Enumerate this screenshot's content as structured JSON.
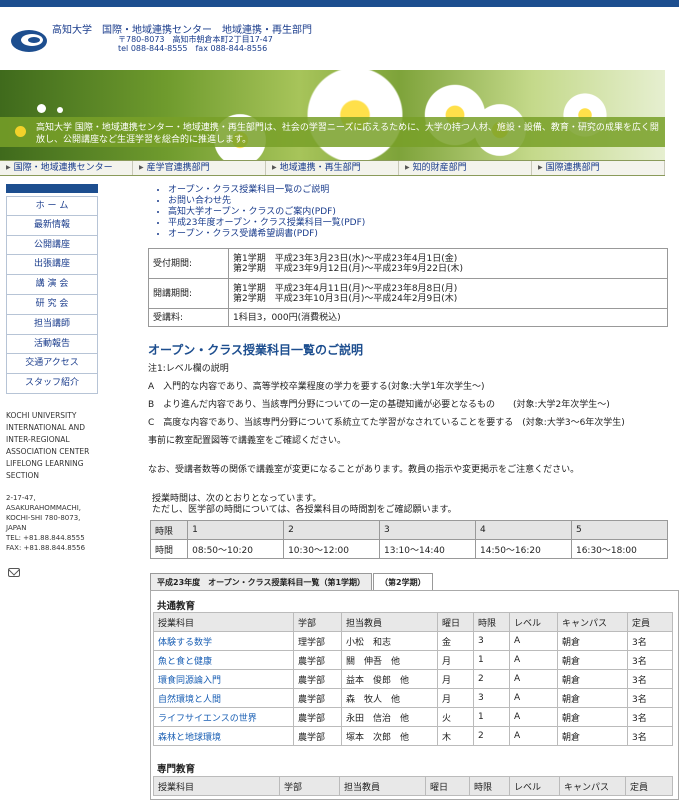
{
  "header": {
    "title": "高知大学　国際・地域連携センター　地域連携・再生部門",
    "addr1": "〒780-8073　高知市朝倉本町2丁目17-47",
    "addr2": "tel 088-844-8555　fax 088-844-8556"
  },
  "banner": {
    "text": "高知大学 国際・地域連携センター・地域連携・再生部門は、社会の学習ニーズに応えるために、大学の持つ人材、施設・設備、教育・研究の成果を広く開放し、公開講座など生涯学習を総合的に推進します。"
  },
  "nav": [
    "国際・地域連携センター",
    "産学官連携部門",
    "地域連携・再生部門",
    "知的財産部門",
    "国際連携部門"
  ],
  "sidebar": {
    "items": [
      "ホ ー ム",
      "最新情報",
      "公開講座",
      "出張講座",
      "講 演 会",
      "研 究 会",
      "担当講師",
      "活動報告",
      "交通アクセス",
      "スタッフ紹介"
    ],
    "en": [
      "KOCHI UNIVERSITY",
      "INTERNATIONAL AND",
      "INTER-REGIONAL",
      "ASSOCIATION CENTER",
      "LIFELONG LEARNING",
      "SECTION"
    ],
    "addr": [
      "2-17-47,",
      "ASAKURAHOMMACHI,",
      "KOCHI-SHI 780-8073,",
      "JAPAN",
      "TEL: +81.88.844.8555",
      "FAX: +81.88.844.8556"
    ]
  },
  "links": [
    "オープン・クラス授業科目一覧のご説明",
    "お問い合わせ先",
    "高知大学オープン・クラスのご案内(PDF)",
    "平成23年度オープン・クラス授業科目一覧(PDF)",
    "オープン・クラス受講希望調書(PDF)"
  ],
  "info": [
    {
      "h": "受付期間:",
      "v1": "第1学期　平成23年3月23日(水)～平成23年4月1日(金)",
      "v2": "第2学期　平成23年9月12日(月)～平成23年9月22日(木)"
    },
    {
      "h": "開講期間:",
      "v1": "第1学期　平成23年4月11日(月)～平成23年8月8日(月)",
      "v2": "第2学期　平成23年10月3日(月)～平成24年2月9日(木)"
    },
    {
      "h": "受講料:",
      "v1": "1科目3，000円(消費税込)",
      "v2": ""
    }
  ],
  "section_title": "オープン・クラス授業科目一覧のご説明",
  "notes": [
    "注1:レベル欄の説明",
    "A　入門的な内容であり、高等学校卒業程度の学力を要する(対象:大学1年次学生～)",
    "B　より進んだ内容であり、当該専門分野についての一定の基礎知識が必要となるもの　　(対象:大学2年次学生～)",
    "C　高度な内容であり、当該専門分野について系統立てた学習がなされていることを要する　(対象:大学3～6年次学生)",
    "事前に教室配置図等で講義室をご確認ください。"
  ],
  "note2": "なお、受講者数等の関係で講義室が変更になることがあります。教員の指示や変更掲示をご注意ください。",
  "time_note": [
    "授業時間は、次のとおりとなっています。",
    "ただし、医学部の時間については、各授業科目の時間割をご確認願います。"
  ],
  "times": {
    "h0": "時限",
    "h1": [
      "1",
      "2",
      "3",
      "4",
      "5"
    ],
    "r0": "時間",
    "r1": [
      "08:50～10:20",
      "10:30～12:00",
      "13:10～14:40",
      "14:50～16:20",
      "16:30～18:00"
    ]
  },
  "tabs": [
    "平成23年度　オープン・クラス授業科目一覧（第1学期）",
    "（第2学期）"
  ],
  "common": {
    "title": "共通教育",
    "headers": [
      "授業科目",
      "学部",
      "担当教員",
      "曜日",
      "時限",
      "レベル",
      "キャンパス",
      "定員"
    ],
    "rows": [
      [
        "体験する数学",
        "理学部",
        "小松　和志",
        "金",
        "3",
        "A",
        "朝倉",
        "3名"
      ],
      [
        "魚と食と健康",
        "農学部",
        "關　伸吾　他",
        "月",
        "1",
        "A",
        "朝倉",
        "3名"
      ],
      [
        "環食同源論入門",
        "農学部",
        "益本　俊郎　他",
        "月",
        "2",
        "A",
        "朝倉",
        "3名"
      ],
      [
        "自然環境と人間",
        "農学部",
        "森　牧人　他",
        "月",
        "3",
        "A",
        "朝倉",
        "3名"
      ],
      [
        "ライフサイエンスの世界",
        "農学部",
        "永田　信治　他",
        "火",
        "1",
        "A",
        "朝倉",
        "3名"
      ],
      [
        "森林と地球環境",
        "農学部",
        "塚本　次郎　他",
        "木",
        "2",
        "A",
        "朝倉",
        "3名"
      ]
    ]
  },
  "special": {
    "title": "専門教育",
    "headers": [
      "授業科目",
      "学部",
      "担当教員",
      "曜日",
      "時限",
      "レベル",
      "キャンパス",
      "定員"
    ]
  }
}
